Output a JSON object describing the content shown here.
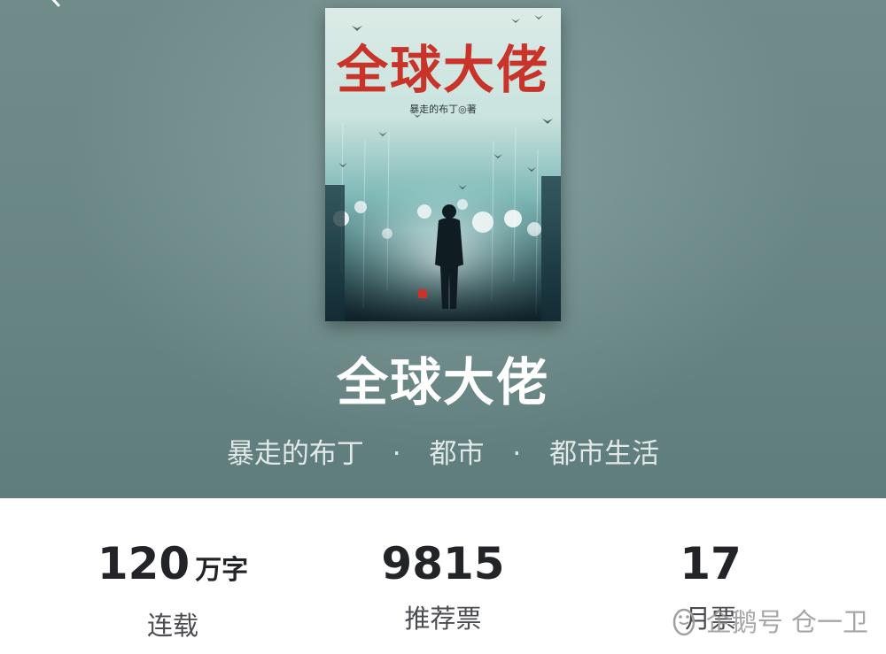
{
  "book": {
    "title": "全球大佬",
    "author": "暴走的布丁",
    "category": "都市",
    "subcategory": "都市生活",
    "separator": "·",
    "cover": {
      "title": "全球大佬",
      "author_line": "暴走的布丁◎著"
    }
  },
  "stats": [
    {
      "value": "120",
      "unit": "万字",
      "label": "连载"
    },
    {
      "value": "9815",
      "unit": "",
      "label": "推荐票"
    },
    {
      "value": "17",
      "unit": "",
      "label": "月票"
    }
  ],
  "watermark": {
    "text": "企鹅号 仓一卫"
  },
  "colors": {
    "hero_bg": "#6a8786",
    "cover_title": "#c8342a",
    "stat_value": "#222427",
    "stat_label": "#4a4c50"
  },
  "icons": {
    "back": "chevron-left-icon",
    "watermark": "penguin-icon"
  }
}
